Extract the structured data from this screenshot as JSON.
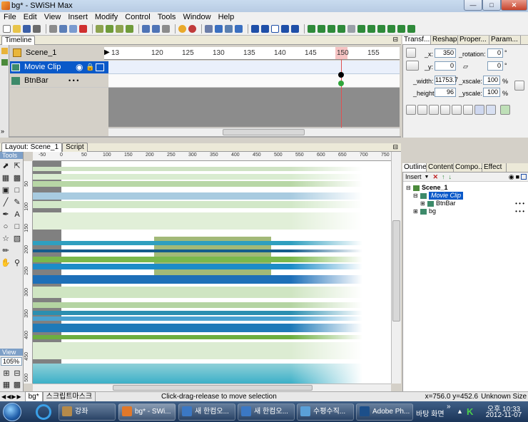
{
  "window": {
    "title": "bg* - SWiSH Max",
    "min_icon": "minimize-icon",
    "max_icon": "maximize-icon",
    "close_icon": "close-icon"
  },
  "menu": [
    "File",
    "Edit",
    "View",
    "Insert",
    "Modify",
    "Control",
    "Tools",
    "Window",
    "Help"
  ],
  "timeline": {
    "tab_label": "Timeline",
    "scene_label": "Scene_1",
    "layers": [
      {
        "name": "Movie Clip",
        "selected": true,
        "dots": ""
      },
      {
        "name": "BtnBar",
        "selected": false,
        "dots": "•  •  •"
      }
    ],
    "frame_ticks": [
      "13",
      "120",
      "125",
      "130",
      "135",
      "140",
      "145",
      "150",
      "155"
    ],
    "playhead_frame": "150",
    "expand_label": "»"
  },
  "layout": {
    "tab_label": "Layout: Scene_1",
    "script_tab": "Script",
    "tools_caption": "Tools",
    "view_caption": "View",
    "zoom": "105%",
    "hruler_ticks": [
      "-50",
      "0",
      "50",
      "100",
      "150",
      "200",
      "250",
      "300",
      "350",
      "400",
      "450",
      "500",
      "550",
      "600",
      "650",
      "700",
      "750"
    ],
    "vruler_ticks": [
      "50",
      "100",
      "150",
      "200",
      "250",
      "300",
      "350",
      "400",
      "450",
      "500"
    ]
  },
  "transform": {
    "tabs": [
      "Transf...",
      "Reshape",
      "Proper...",
      "Param..."
    ],
    "x_label": "_x:",
    "x_value": "350",
    "y_label": "_y:",
    "y_value": "0",
    "rotation_label": "_rotation:",
    "rotation_value": "0",
    "rotation_unit": "°",
    "skew_value": "0",
    "skew_unit": "°",
    "width_label": "_width:",
    "width_value": "11753.7",
    "height_label": "_height:",
    "height_value": "96",
    "xscale_label": "_xscale:",
    "xscale_value": "100",
    "yscale_label": "_yscale:",
    "yscale_value": "100",
    "pct": "%"
  },
  "outline": {
    "tabs": [
      "Outline",
      "Content",
      "Compo...",
      "Effect"
    ],
    "insert_label": "Insert",
    "tree": [
      {
        "label": "Scene_1",
        "level": 0,
        "bold": true,
        "selected": false,
        "dots": ""
      },
      {
        "label": "Movie Clip",
        "level": 1,
        "bold": false,
        "selected": true,
        "dots": ""
      },
      {
        "label": "BtnBar",
        "level": 2,
        "bold": false,
        "selected": false,
        "dots": "•  •  •"
      },
      {
        "label": "bg",
        "level": 1,
        "bold": false,
        "selected": false,
        "dots": "•  •  •"
      }
    ]
  },
  "status": {
    "bottom_tab1": "bg*",
    "bottom_tab2": "스크립트마스크",
    "message": "Click-drag-release to move selection",
    "coords": "x=756.0 y=452.6",
    "size": "Unknown Size"
  },
  "taskbar": {
    "items": [
      {
        "label": "강좌",
        "color": "#b58a4a"
      },
      {
        "label": "bg* - SWi...",
        "color": "#e0782a"
      },
      {
        "label": "새 한컴오...",
        "color": "#3b78c4"
      },
      {
        "label": "새 한컴오...",
        "color": "#3b78c4"
      },
      {
        "label": "수평수직...",
        "color": "#5aa0d8"
      },
      {
        "label": "Adobe Ph...",
        "color": "#1c4f8a"
      }
    ],
    "desktop_label": "바탕 화면",
    "chevron": "»",
    "time": "오후 10:33",
    "date": "2012-11-07"
  }
}
